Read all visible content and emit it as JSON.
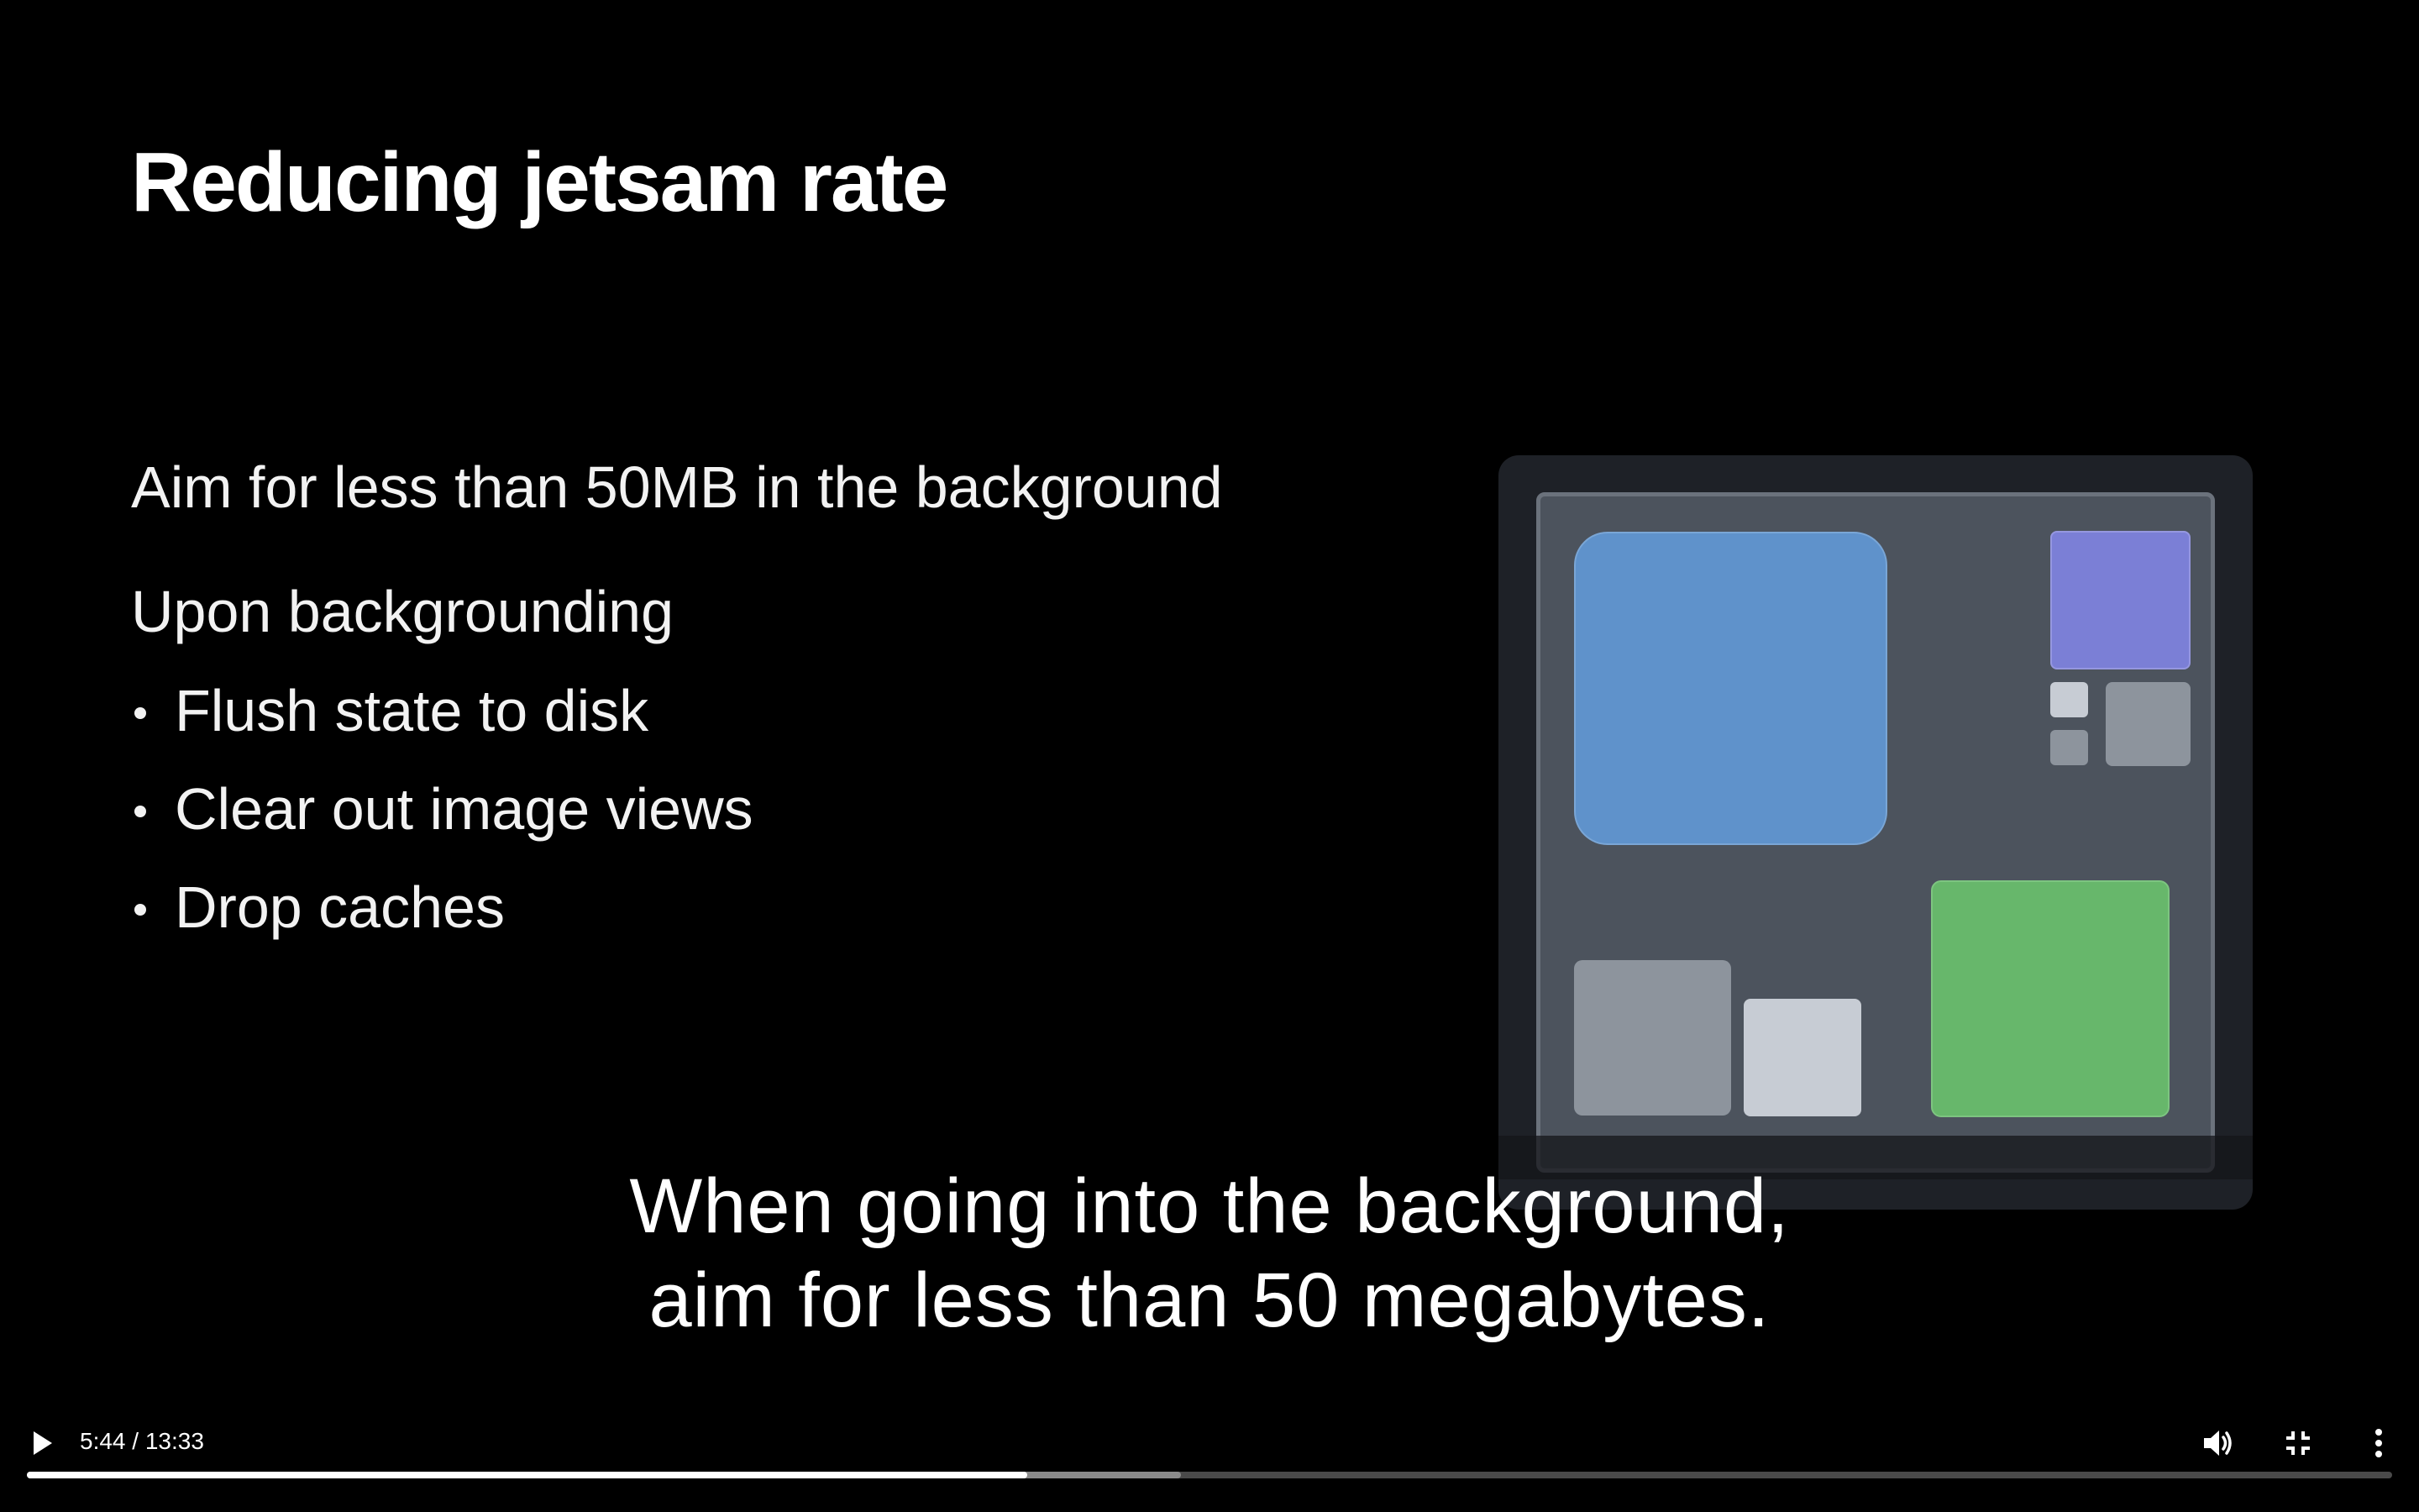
{
  "slide": {
    "title": "Reducing jetsam rate",
    "lines": [
      "Aim for less than 50MB in the background",
      "Upon backgrounding"
    ],
    "bullets": [
      "Flush state to disk",
      "Clear out image views",
      "Drop caches"
    ]
  },
  "captions": {
    "line1": "When going into the background,",
    "line2": "aim for less than 50 megabytes."
  },
  "player": {
    "play_icon": "play-icon",
    "time": "5:44 / 13:33",
    "played_fraction": 0.423,
    "buffered_fraction": 0.488,
    "icons": [
      "volume-icon",
      "exit-fullscreen-icon",
      "more-options-icon"
    ]
  },
  "illustration": {
    "colors": {
      "blue": "#5f92cb",
      "purple": "#7b7fd6",
      "green": "#67b76b",
      "gray": "#8d949d",
      "light_gray": "#c7ccd4"
    }
  }
}
